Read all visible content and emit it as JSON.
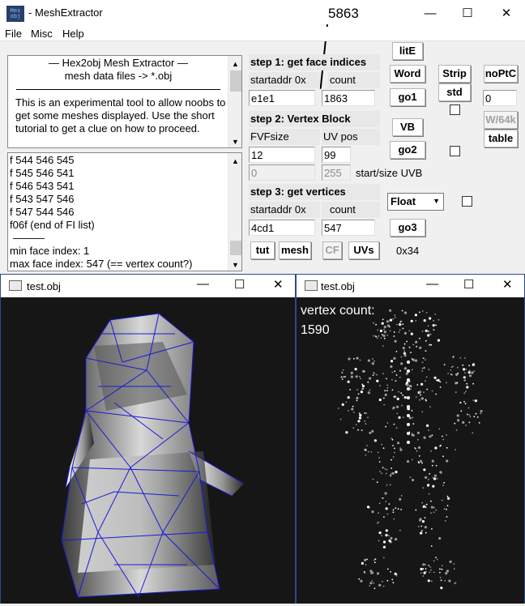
{
  "main_window": {
    "title": "- MeshExtractor",
    "icon_text_top": "Hex",
    "icon_text_bottom": "obj",
    "annotation": "5863"
  },
  "menu": [
    "File",
    "Misc",
    "Help"
  ],
  "info_text": {
    "header_line1": "—   Hex2obj Mesh Extractor   —",
    "header_line2": "mesh data files -> *.obj",
    "body": "This is an experimental tool to allow noobs to get some meshes displayed. Use the short tutorial to get a clue on how to proceed."
  },
  "log_lines": [
    "f  544 546 545",
    "f  545 546 541",
    "f  546 543 541",
    "f  543 547 546",
    "f  547 544 546",
    "f06f (end of FI list)",
    "———",
    "min face index: 1",
    "max face index: 547 (== vertex count?)"
  ],
  "step1": {
    "label": "step 1: get face indices",
    "startaddr_label": "startaddr 0x",
    "count_label": "count",
    "startaddr": "e1e1",
    "count": "1863"
  },
  "step2": {
    "label": "step 2: Vertex Block",
    "fvfsize_label": "FVFsize",
    "uvpos_label": "UV pos",
    "fvfsize": "12",
    "uvpos": "99",
    "uvb_start": "0",
    "uvb_size": "255",
    "uvb_label": "start/size UVB"
  },
  "step3": {
    "label": "step 3: get vertices",
    "startaddr_label": "startaddr 0x",
    "count_label": "count",
    "startaddr": "4cd1",
    "count": "547"
  },
  "buttons": {
    "lite": "litE",
    "word": "Word",
    "go1": "go1",
    "vb": "VB",
    "go2": "go2",
    "go3": "go3",
    "strip": "Strip",
    "std": "std",
    "noptc": "noPtC",
    "w64k": "W/64k",
    "table": "table",
    "tut": "tut",
    "mesh": "mesh",
    "cf": "CF",
    "uvs": "UVs"
  },
  "float_select": "Float",
  "noptc_value": "0",
  "offset_label": "0x34",
  "viewer_left": {
    "title": "test.obj"
  },
  "viewer_right": {
    "title": "test.obj",
    "vertex_count_label": "vertex count:",
    "vertex_count": "1590"
  },
  "colors": {
    "wireframe": "#1a1ad8",
    "background_dark": "#161616"
  }
}
